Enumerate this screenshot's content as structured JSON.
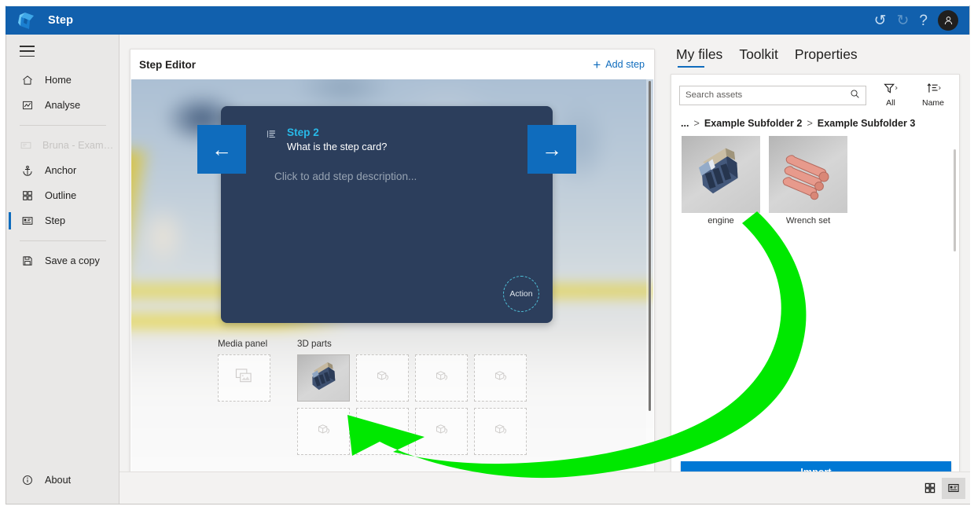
{
  "titlebar": {
    "app_name": "Step",
    "logo_icon": "step-logo-icon",
    "undo_icon": "↺",
    "redo_icon": "↻",
    "help_icon": "?",
    "avatar_icon": "person-icon",
    "avatar_glyph": "⬤"
  },
  "sidebar": {
    "menu_icon": "hamburger-icon",
    "items": [
      {
        "label": "Home",
        "icon": "home-icon",
        "state": "normal"
      },
      {
        "label": "Analyse",
        "icon": "analyse-icon",
        "state": "normal"
      },
      {
        "label": "Bruna - Example Gui...",
        "icon": "guide-icon",
        "state": "disabled"
      },
      {
        "label": "Anchor",
        "icon": "anchor-icon",
        "state": "normal"
      },
      {
        "label": "Outline",
        "icon": "outline-icon",
        "state": "normal"
      },
      {
        "label": "Step",
        "icon": "step-icon",
        "state": "selected"
      },
      {
        "label": "Save a copy",
        "icon": "save-icon",
        "state": "normal"
      }
    ],
    "about": {
      "label": "About",
      "icon": "info-icon"
    }
  },
  "editor": {
    "title": "Step Editor",
    "add_step_label": "Add step",
    "add_step_plus": "+",
    "step_card": {
      "list_icon": "list-icon",
      "step_number": "Step 2",
      "step_title": "What is the step card?",
      "description_placeholder": "Click to add step description...",
      "action_label": "Action",
      "prev_arrow": "←",
      "next_arrow": "→",
      "accent_color": "#28b9e8",
      "card_color": "#2c3e5c",
      "arrow_button_color": "#0f6cbd"
    },
    "media_panel": {
      "label": "Media panel",
      "slots": [
        {
          "type": "empty",
          "icon": "image-placeholder-icon"
        }
      ]
    },
    "parts_panel": {
      "label": "3D parts",
      "slots": [
        {
          "type": "filled",
          "icon": "engine-thumbnail"
        },
        {
          "type": "empty",
          "icon": "cube-placeholder-icon"
        },
        {
          "type": "empty",
          "icon": "cube-placeholder-icon"
        },
        {
          "type": "empty",
          "icon": "cube-placeholder-icon"
        },
        {
          "type": "empty",
          "icon": "cube-placeholder-icon"
        },
        {
          "type": "empty",
          "icon": "cube-placeholder-icon"
        },
        {
          "type": "empty",
          "icon": "cube-placeholder-icon"
        },
        {
          "type": "empty",
          "icon": "cube-placeholder-icon"
        }
      ]
    }
  },
  "right_panel": {
    "tabs": [
      {
        "label": "My files",
        "active": true
      },
      {
        "label": "Toolkit",
        "active": false
      },
      {
        "label": "Properties",
        "active": false
      }
    ],
    "search": {
      "placeholder": "Search assets",
      "value": "",
      "icon": "search-icon"
    },
    "filter": {
      "label": "All",
      "icon": "filter-icon",
      "chevron": "›"
    },
    "sort": {
      "label": "Name",
      "icon": "sort-icon",
      "chevron": "›"
    },
    "breadcrumb": {
      "overflow": "...",
      "separator": ">",
      "items": [
        "Example Subfolder 2",
        "Example Subfolder 3"
      ]
    },
    "assets": [
      {
        "name": "engine",
        "thumb": "engine-render"
      },
      {
        "name": "Wrench set",
        "thumb": "wrench-set-render"
      }
    ],
    "import_label": "Import"
  },
  "footer": {
    "grid_view_icon": "grid-view-icon",
    "card_view_icon": "card-view-icon",
    "active_view": "card-view-icon"
  },
  "annotation": {
    "arrow_color": "#00E800",
    "description": "curved arrow from engine asset to 3D parts slot"
  }
}
